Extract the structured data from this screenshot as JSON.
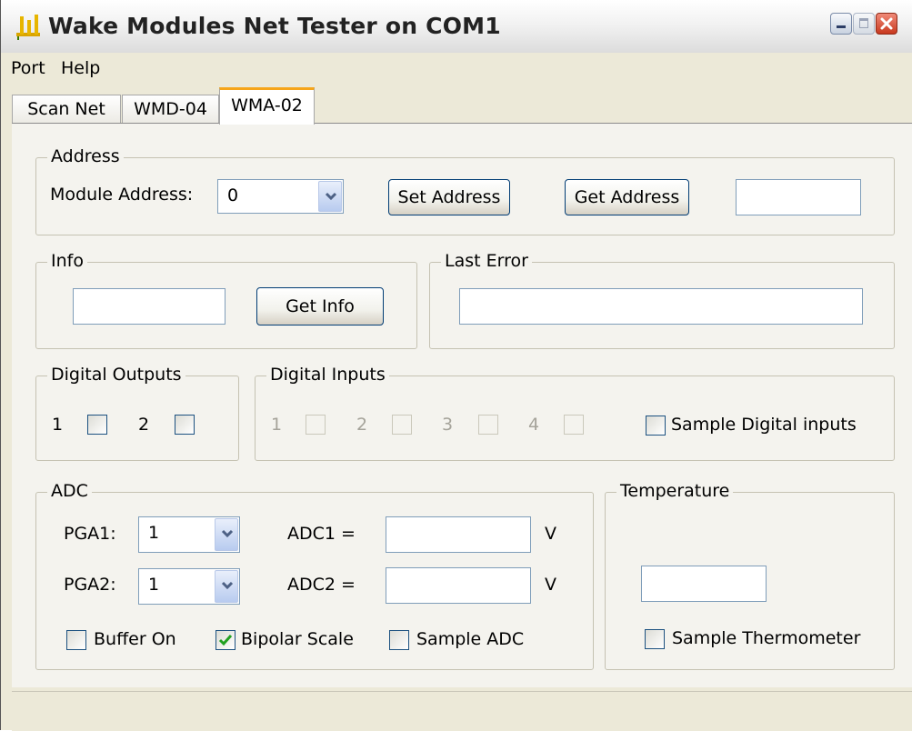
{
  "window": {
    "title": "Wake Modules Net Tester on COM1"
  },
  "menu": {
    "port": "Port",
    "help": "Help"
  },
  "tabs": {
    "scan_net": "Scan Net",
    "wmd04": "WMD-04",
    "wma02": "WMA-02"
  },
  "address": {
    "group_title": "Address",
    "module_label": "Module Address:",
    "module_value": "0",
    "set_button": "Set Address",
    "get_button": "Get Address",
    "output_value": ""
  },
  "info": {
    "group_title": "Info",
    "value": "",
    "button": "Get Info"
  },
  "last_error": {
    "group_title": "Last Error",
    "value": ""
  },
  "digital_outputs": {
    "group_title": "Digital Outputs",
    "items": [
      {
        "label": "1",
        "checked": false
      },
      {
        "label": "2",
        "checked": false
      }
    ]
  },
  "digital_inputs": {
    "group_title": "Digital Inputs",
    "items": [
      {
        "label": "1"
      },
      {
        "label": "2"
      },
      {
        "label": "3"
      },
      {
        "label": "4"
      }
    ],
    "sample_label": "Sample Digital inputs",
    "sample_checked": false
  },
  "adc": {
    "group_title": "ADC",
    "pga1_label": "PGA1:",
    "pga1_value": "1",
    "pga2_label": "PGA2:",
    "pga2_value": "1",
    "adc1_label": "ADC1 =",
    "adc1_value": "",
    "adc1_unit": "V",
    "adc2_label": "ADC2 =",
    "adc2_value": "",
    "adc2_unit": "V",
    "buffer_label": "Buffer On",
    "buffer_checked": false,
    "bipolar_label": "Bipolar Scale",
    "bipolar_checked": true,
    "sample_label": "Sample ADC",
    "sample_checked": false
  },
  "temperature": {
    "group_title": "Temperature",
    "value": "",
    "sample_label": "Sample Thermometer",
    "sample_checked": false
  },
  "colors": {
    "tab_highlight": "#f6a51a",
    "checkmark": "#21a121",
    "close_button": "#c8391f"
  }
}
